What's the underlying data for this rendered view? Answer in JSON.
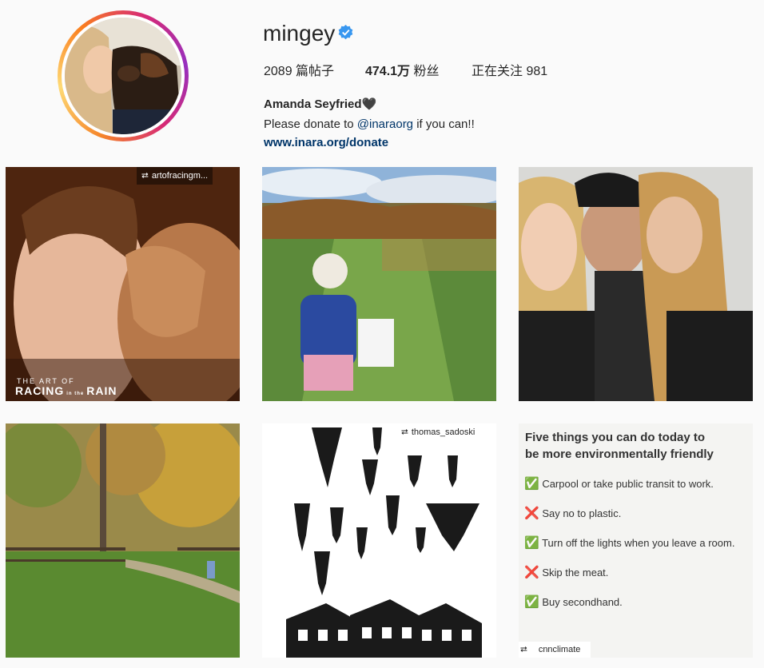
{
  "profile": {
    "username": "mingey",
    "posts_label": "2089 篇帖子",
    "followers_count": "474.1万",
    "followers_label": " 粉丝",
    "following_label": "正在关注 981",
    "full_name": "Amanda Seyfried🖤",
    "bio_prefix": "Please donate to ",
    "bio_mention": "@inaraorg",
    "bio_suffix": " if you can!!",
    "website": "www.inara.org/donate"
  },
  "posts": [
    {
      "repost_user": "artofracingm...",
      "caption_top": "THE ART OF",
      "caption_main": "RACING",
      "caption_small": "in the",
      "caption_end": "RAIN"
    },
    {},
    {},
    {},
    {
      "repost_user": "thomas_sadoski"
    },
    {
      "heading_line1": "Five things you can do today to",
      "heading_line2": "be more environmentally friendly",
      "items": [
        {
          "mark": "✅",
          "text": "Carpool or take public transit to work."
        },
        {
          "mark": "❌",
          "text": "Say no to plastic."
        },
        {
          "mark": "✅",
          "text": "Turn off the lights when you leave a room."
        },
        {
          "mark": "❌",
          "text": "Skip the meat."
        },
        {
          "mark": "✅",
          "text": "Buy secondhand."
        }
      ],
      "credit": "cnnclimate"
    }
  ],
  "colors": {
    "link": "#003569",
    "verified": "#3897f0",
    "background": "#fafafa"
  }
}
